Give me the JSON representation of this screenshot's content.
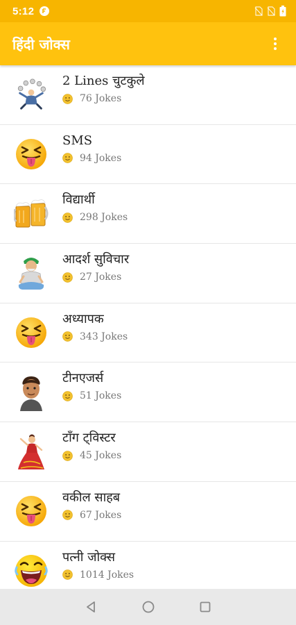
{
  "status_bar": {
    "time": "5:12",
    "icons": [
      "app-notification-icon",
      "no-sim-icon",
      "no-sim-icon",
      "battery-icon"
    ]
  },
  "app_bar": {
    "title": "हिंदी जोक्स",
    "menu_icon": "more-vert-icon"
  },
  "colors": {
    "status_bar": "#F7B500",
    "app_bar": "#FFC20E",
    "divider": "#e6e6e6",
    "title_text": "#222222",
    "count_text": "#777777",
    "nav_bar": "#e9e9e9"
  },
  "categories": [
    {
      "title": "2 Lines चुटकुले",
      "count": "76 Jokes",
      "icon": "juggler-icon"
    },
    {
      "title": "SMS",
      "count": "94 Jokes",
      "icon": "tongue-out-emoji-icon"
    },
    {
      "title": "विद्यार्थी",
      "count": "298 Jokes",
      "icon": "beer-mugs-icon"
    },
    {
      "title": "आदर्श सुविचार",
      "count": "27 Jokes",
      "icon": "sitting-man-icon"
    },
    {
      "title": "अध्यापक",
      "count": "343 Jokes",
      "icon": "tongue-out-emoji-icon"
    },
    {
      "title": "टीनएजर्स",
      "count": "51 Jokes",
      "icon": "boy-avatar-icon"
    },
    {
      "title": "टाँग ट्विस्टर",
      "count": "45 Jokes",
      "icon": "woman-dancer-icon"
    },
    {
      "title": "वकील साहब",
      "count": "67 Jokes",
      "icon": "tongue-out-emoji-icon"
    },
    {
      "title": "पत्नी जोक्स",
      "count": "1014 Jokes",
      "icon": "laughing-emoji-icon"
    }
  ],
  "count_icon": "smiley-icon",
  "nav_bar": {
    "icons": [
      "back-icon",
      "home-icon",
      "recents-icon"
    ]
  }
}
